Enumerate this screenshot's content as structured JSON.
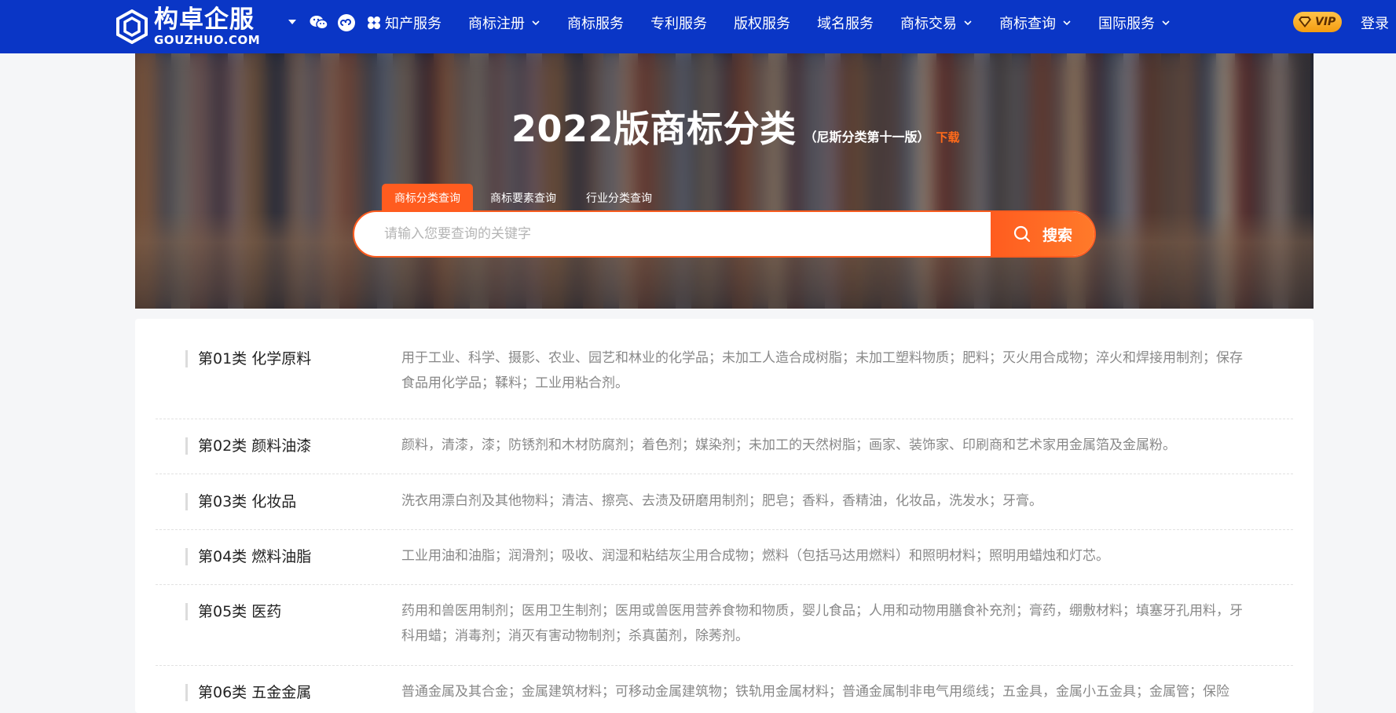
{
  "header": {
    "logo": {
      "cn": "构卓企服",
      "en": "GOUZHUO.COM"
    },
    "nav": [
      {
        "label": "知产服务",
        "has_icon": true,
        "dropdown": false
      },
      {
        "label": "商标注册",
        "dropdown": true
      },
      {
        "label": "商标服务",
        "dropdown": false
      },
      {
        "label": "专利服务",
        "dropdown": false
      },
      {
        "label": "版权服务",
        "dropdown": false
      },
      {
        "label": "域名服务",
        "dropdown": false
      },
      {
        "label": "商标交易",
        "dropdown": true
      },
      {
        "label": "商标查询",
        "dropdown": true
      },
      {
        "label": "国际服务",
        "dropdown": true
      }
    ],
    "vip_label": "VIP",
    "login_label": "登录",
    "colors": {
      "brand": "#0a36c6",
      "accent": "#ff5c1f"
    }
  },
  "banner": {
    "title": "2022版商标分类",
    "subtitle": "（尼斯分类第十一版）",
    "download_label": "下载",
    "tabs": [
      {
        "label": "商标分类查询",
        "active": true
      },
      {
        "label": "商标要素查询",
        "active": false
      },
      {
        "label": "行业分类查询",
        "active": false
      }
    ],
    "search": {
      "placeholder": "请输入您要查询的关键字",
      "button_label": "搜索"
    }
  },
  "classes": [
    {
      "name": "第01类 化学原料",
      "desc": "用于工业、科学、摄影、农业、园艺和林业的化学品；未加工人造合成树脂；未加工塑料物质；肥料；灭火用合成物；淬火和焊接用制剂；保存食品用化学品；鞣料；工业用粘合剂。"
    },
    {
      "name": "第02类 颜料油漆",
      "desc": "颜料，清漆，漆；防锈剂和木材防腐剂；着色剂；媒染剂；未加工的天然树脂；画家、装饰家、印刷商和艺术家用金属箔及金属粉。"
    },
    {
      "name": "第03类 化妆品",
      "desc": "洗衣用漂白剂及其他物料；清洁、擦亮、去渍及研磨用制剂；肥皂；香料，香精油，化妆品，洗发水；牙膏。"
    },
    {
      "name": "第04类 燃料油脂",
      "desc": "工业用油和油脂；润滑剂；吸收、润湿和粘结灰尘用合成物；燃料（包括马达用燃料）和照明材料；照明用蜡烛和灯芯。"
    },
    {
      "name": "第05类 医药",
      "desc": "药用和兽医用制剂；医用卫生制剂；医用或兽医用营养食物和物质，婴儿食品；人用和动物用膳食补充剂；膏药，绷敷材料；填塞牙孔用料，牙科用蜡；消毒剂；消灭有害动物制剂；杀真菌剂，除莠剂。"
    },
    {
      "name": "第06类 五金金属",
      "desc": "普通金属及其合金；金属建筑材料；可移动金属建筑物；铁轨用金属材料；普通金属制非电气用缆线；五金具，金属小五金具；金属管；保险"
    }
  ]
}
